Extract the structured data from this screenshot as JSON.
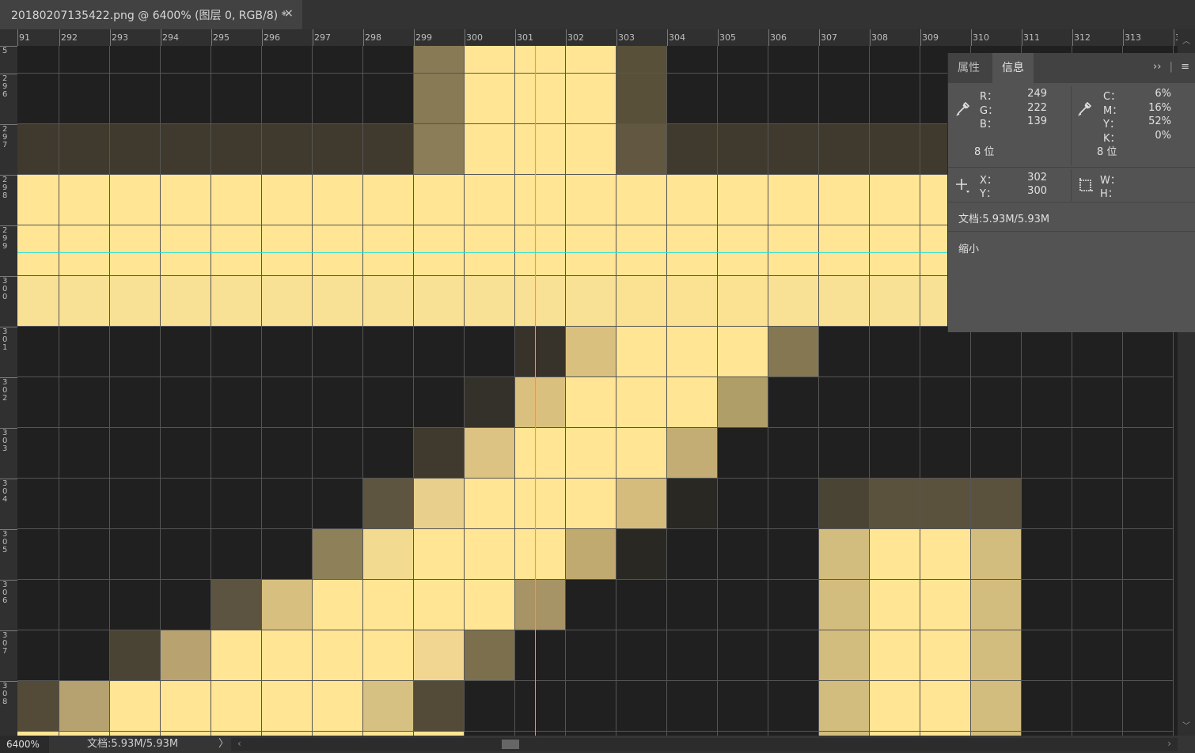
{
  "document_tab": {
    "title": "20180207135422.png @ 6400% (图层 0, RGB/8) *",
    "close_icon": "×"
  },
  "ruler": {
    "top_labels": [
      "91",
      "292",
      "293",
      "294",
      "295",
      "296",
      "297",
      "298",
      "299",
      "300",
      "301",
      "302",
      "303",
      "304",
      "305",
      "306",
      "307",
      "308",
      "309",
      "310",
      "311",
      "312",
      "313",
      "3"
    ],
    "left_labels": [
      "5",
      "296",
      "297",
      "298",
      "299",
      "300",
      "301",
      "302",
      "303",
      "304",
      "305",
      "306",
      "307",
      "308"
    ]
  },
  "canvas_colors": {
    "dark": "#202020",
    "yellow": "#ffe594",
    "guide": "#26e0e0"
  },
  "info_panel": {
    "tabs": [
      "属性",
      "信息"
    ],
    "active_tab": "信息",
    "menu_expand": "››",
    "menu_icon": "≡",
    "rgb": {
      "r_label": "R：",
      "r": "249",
      "g_label": "G：",
      "g": "222",
      "b_label": "B：",
      "b": "139",
      "bits": "8 位"
    },
    "cmyk": {
      "c_label": "C：",
      "c": "6%",
      "m_label": "M：",
      "m": "16%",
      "y_label": "Y：",
      "y": "52%",
      "k_label": "K：",
      "k": "0%",
      "bits": "8 位"
    },
    "pos": {
      "x_label": "X：",
      "x": "302",
      "y_label": "Y：",
      "y": "300"
    },
    "size": {
      "w_label": "W：",
      "h_label": "H："
    },
    "doc": "文档:5.93M/5.93M",
    "hint": "缩小"
  },
  "status_bar": {
    "zoom": "6400%",
    "doc": "文档:5.93M/5.93M",
    "arrow": "〉",
    "scroll_left": "‹",
    "scroll_right": "›"
  },
  "scrollbar": {
    "up": "︿",
    "down": "﹀"
  }
}
